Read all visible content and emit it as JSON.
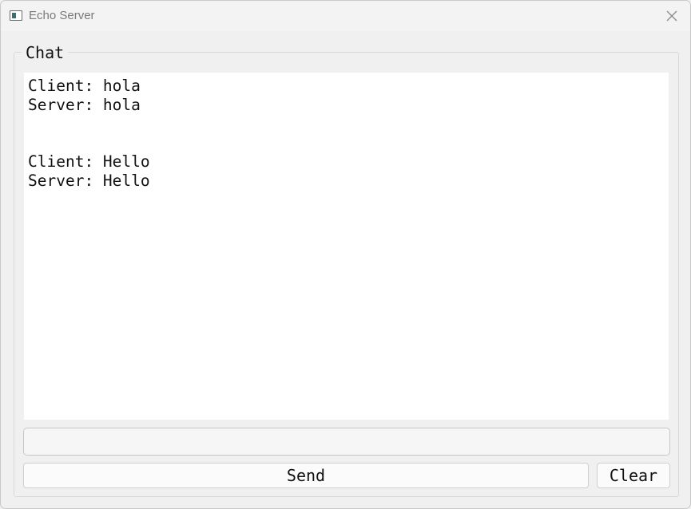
{
  "window": {
    "title": "Echo Server",
    "icon": "app-window-icon",
    "close_icon": "close-icon"
  },
  "group": {
    "title": "Chat"
  },
  "chat": {
    "lines": [
      "Client: hola",
      "Server: hola",
      "",
      "Client: Hello",
      "Server: Hello"
    ]
  },
  "input": {
    "value": "",
    "placeholder": ""
  },
  "buttons": {
    "send_label": "Send",
    "clear_label": "Clear"
  }
}
